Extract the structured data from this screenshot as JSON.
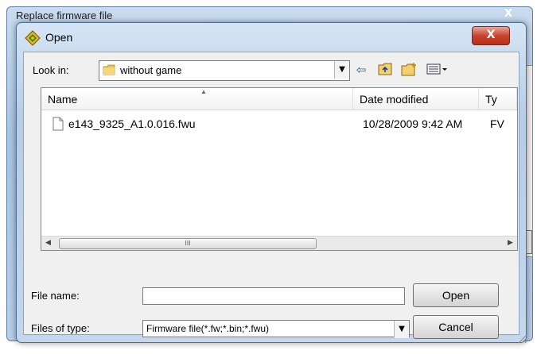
{
  "background_window": {
    "title": "Replace firmware file",
    "close_glyph": "X"
  },
  "dialog": {
    "title": "Open",
    "close_glyph": "X"
  },
  "look_in": {
    "label": "Look in:",
    "value": "without game"
  },
  "toolbar": {
    "icons": [
      "back-arrow-icon",
      "up-folder-icon",
      "new-folder-icon",
      "view-menu-icon"
    ]
  },
  "file_list": {
    "columns": [
      "Name",
      "Date modified",
      "Ty"
    ],
    "rows": [
      {
        "name": "e143_9325_A1.0.016.fwu",
        "date": "10/28/2009 9:42 AM",
        "type": "FV"
      }
    ],
    "scroll_grip": "III"
  },
  "file_name": {
    "label": "File name:",
    "value": ""
  },
  "file_type": {
    "label": "Files of type:",
    "value": "Firmware file(*.fw;*.bin;*.fwu)"
  },
  "buttons": {
    "open": "Open",
    "cancel": "Cancel"
  }
}
